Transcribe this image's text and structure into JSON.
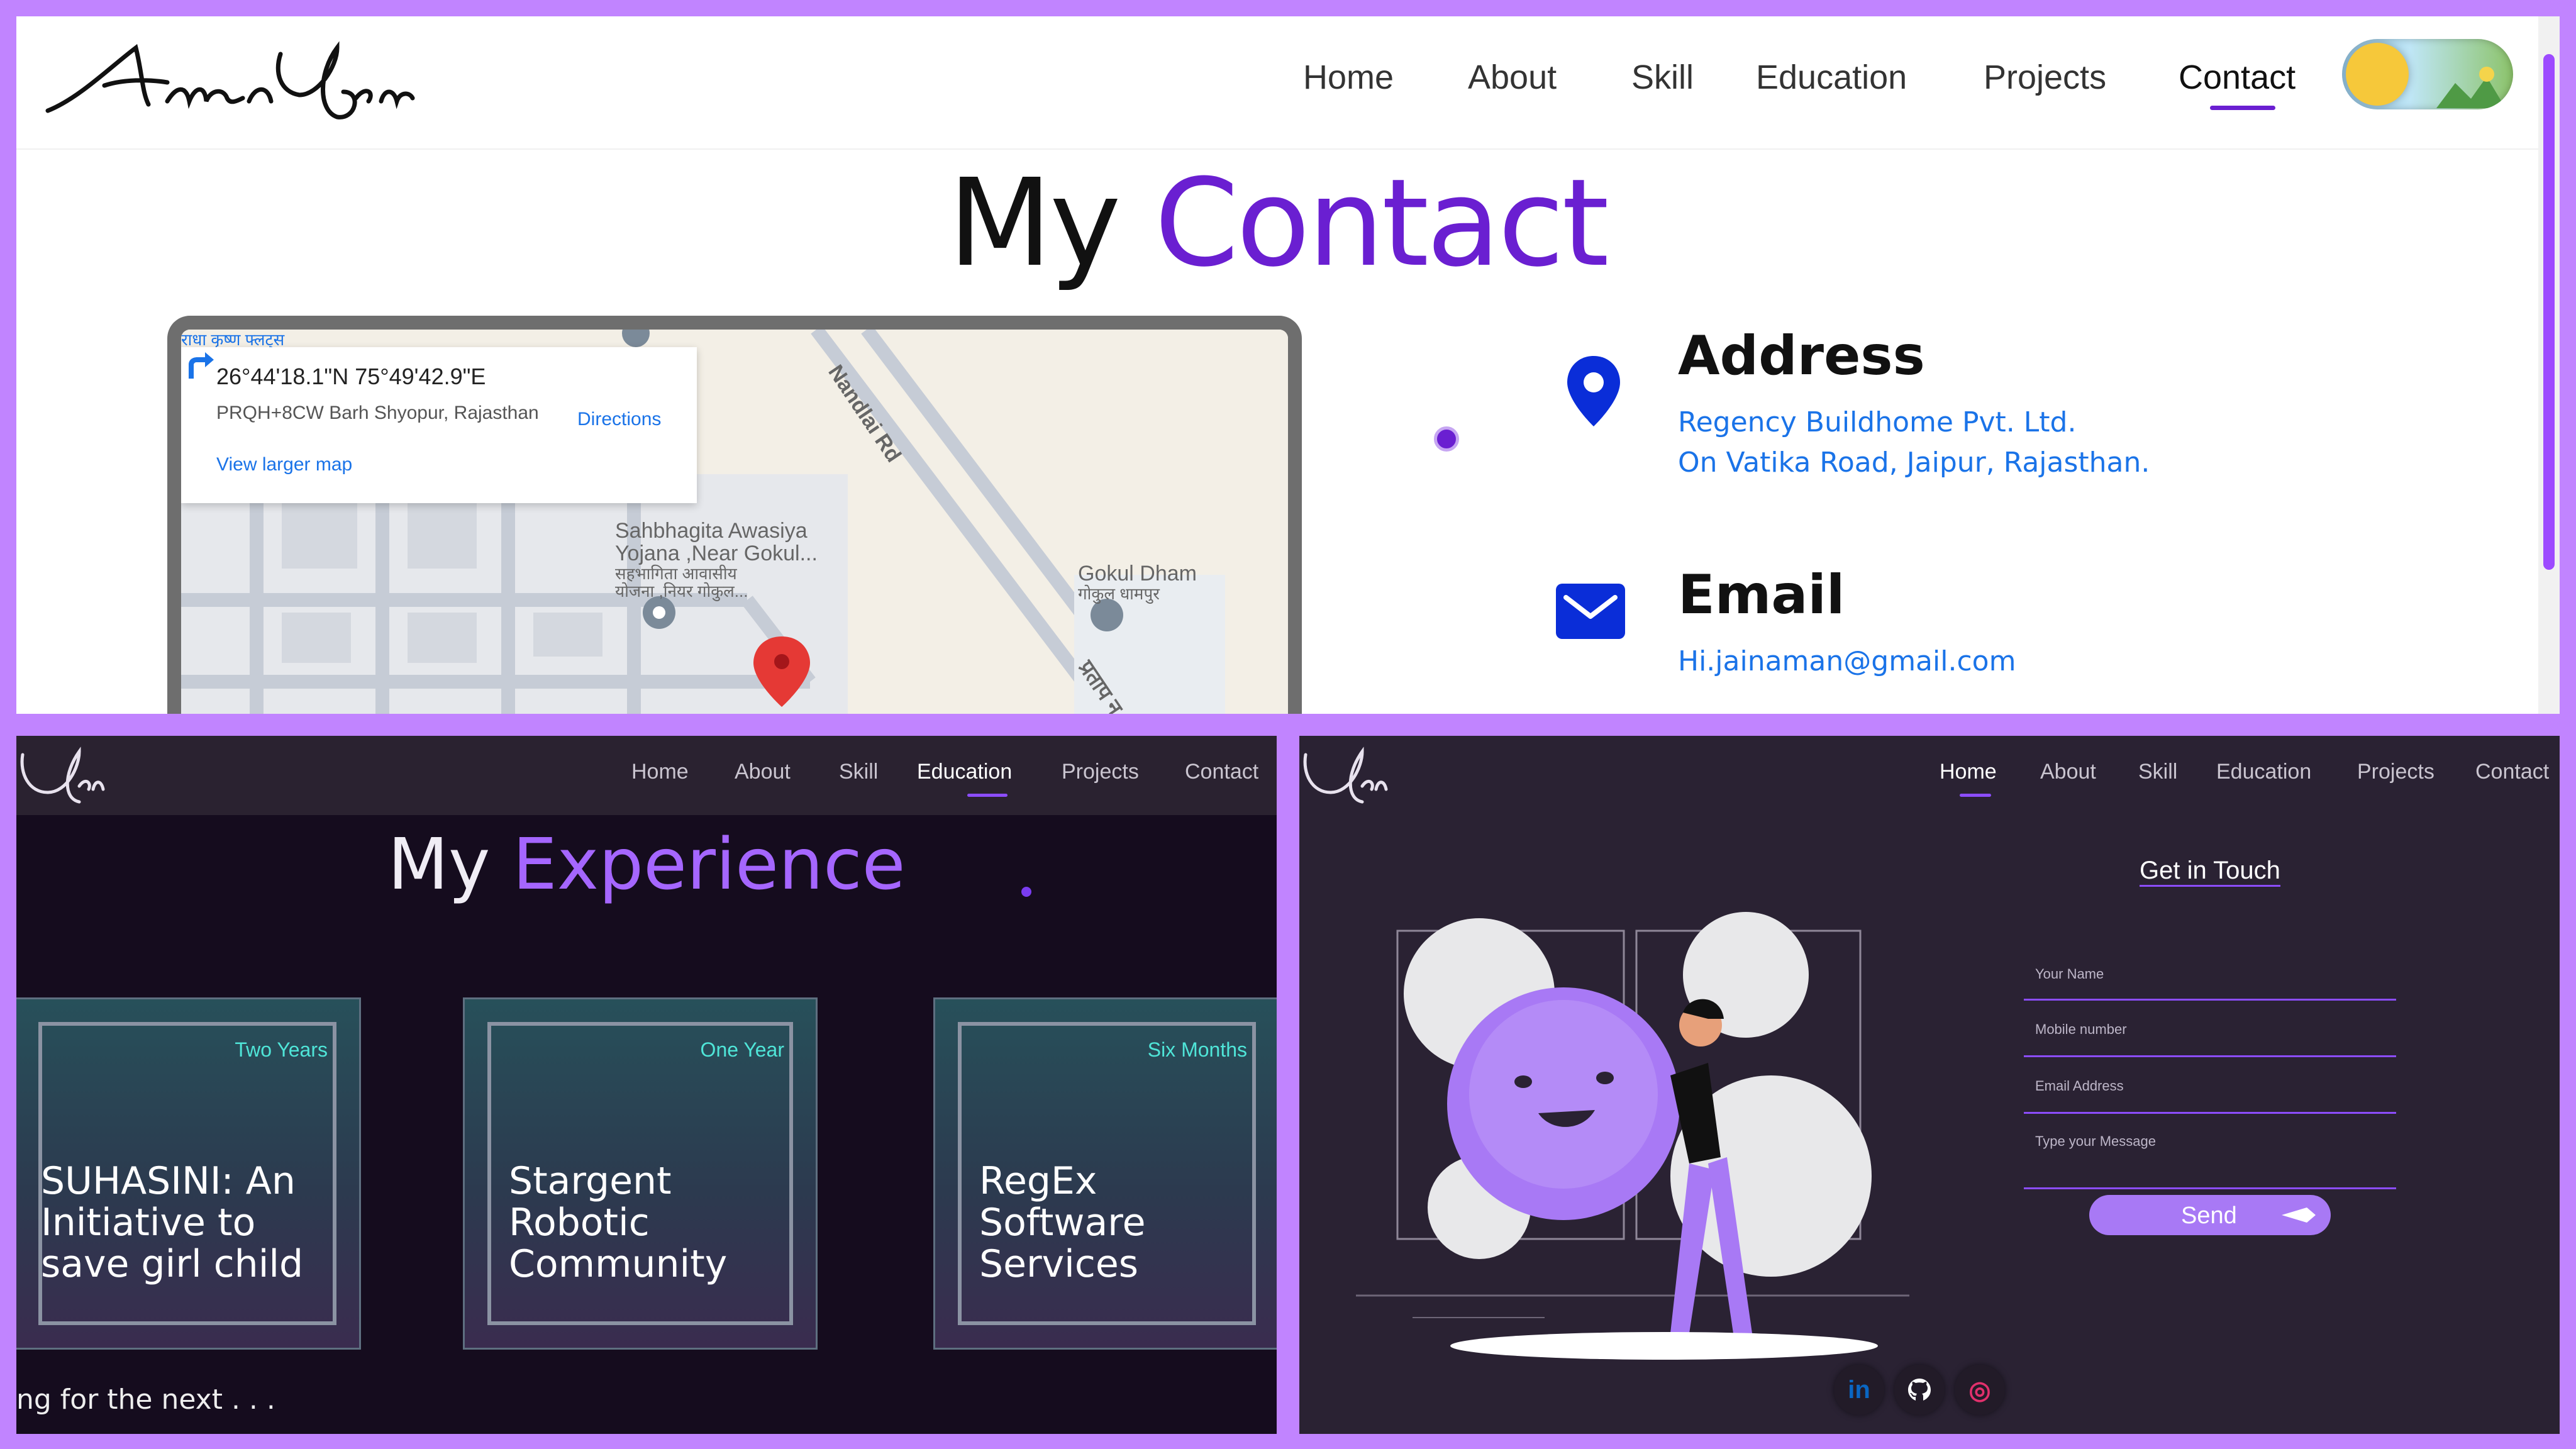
{
  "contact_page": {
    "logo": "Aman Jain",
    "nav": [
      "Home",
      "About",
      "Skill",
      "Education",
      "Projects",
      "Contact"
    ],
    "active_nav": "Contact",
    "title_plain": "My",
    "title_accent": "Contact",
    "map": {
      "coordinates": "26°44'18.1\"N 75°49'42.9\"E",
      "plus_code": "PRQH+8CW Barh Shyopur, Rajasthan",
      "directions": "Directions",
      "larger_map": "View larger map",
      "place_top": "राधा कृष्ण फ्लट्स",
      "place1": "Sahbhagita Awasiya",
      "place1b": "Yojana ,Near Gokul...",
      "place1_hi1": "सहभागिता आवासीय",
      "place1_hi2": "योजना ,नियर गोकुल...",
      "place2": "Gokul Dham",
      "place2_hi": "गोकुल धामपुर",
      "road1": "Nandlai Rd",
      "road2": "प्रताप न"
    },
    "address_heading": "Address",
    "address_line1": "Regency Buildhome Pvt. Ltd.",
    "address_line2": "On Vatika Road, Jaipur, Rajasthan.",
    "email_heading": "Email",
    "email_value": "Hi.jainaman@gmail.com",
    "accent_color": "#6a1fd1",
    "link_color": "#1a73e8"
  },
  "experience_page": {
    "logo": "Jain",
    "nav": [
      "Home",
      "About",
      "Skill",
      "Education",
      "Projects",
      "Contact"
    ],
    "active_nav": "Education",
    "title_plain": "My",
    "title_accent": "Experience",
    "cards": [
      {
        "duration": "Two Years",
        "title_lines": [
          "SUHASINI: An",
          "Initiative to",
          "save girl child"
        ]
      },
      {
        "duration": "One Year",
        "title_lines": [
          "Stargent",
          "Robotic",
          "Community"
        ]
      },
      {
        "duration": "Six Months",
        "title_lines": [
          "RegEx",
          "Software",
          "Services"
        ]
      }
    ],
    "footer_text": "ng for the next . . ."
  },
  "touch_page": {
    "logo": "Jain",
    "nav": [
      "Home",
      "About",
      "Skill",
      "Education",
      "Projects",
      "Contact"
    ],
    "active_nav": "Home",
    "heading": "Get in Touch",
    "fields": [
      "Your Name",
      "Mobile number",
      "Email Address",
      "Type your Message"
    ],
    "send_label": "Send",
    "socials": [
      {
        "icon": "linkedin-icon",
        "glyph": "in",
        "color": "#0a66c2"
      },
      {
        "icon": "github-icon",
        "glyph": "",
        "color": "#ffffff"
      },
      {
        "icon": "instagram-icon",
        "glyph": "◎",
        "color": "#e1306c"
      }
    ]
  }
}
